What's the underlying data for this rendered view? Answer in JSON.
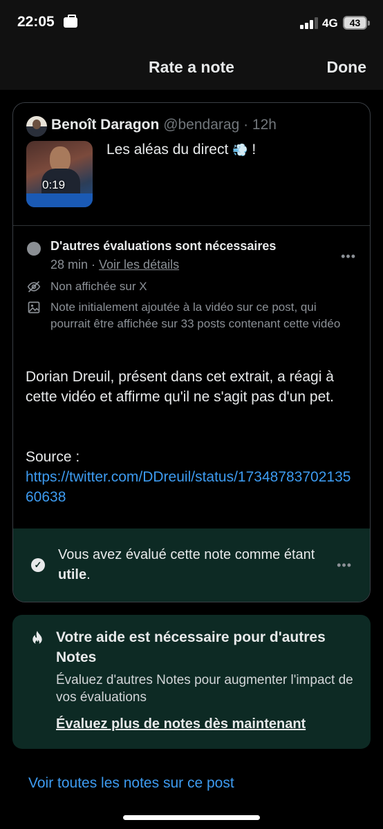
{
  "status_bar": {
    "time": "22:05",
    "network": "4G",
    "battery": "43"
  },
  "header": {
    "title": "Rate a note",
    "done_label": "Done"
  },
  "post": {
    "author_name": "Benoît Daragon",
    "author_handle": "@bendarag · 12h",
    "text": "Les aléas du direct",
    "emoji_after": "💨",
    "exclaim": " !",
    "video_duration": "0:19"
  },
  "note": {
    "status": "D'autres évaluations sont nécessaires",
    "age": "28 min",
    "separator": " · ",
    "details_link": "Voir les détails",
    "visibility": "Non affichée sur X",
    "media_info": "Note initialement ajoutée à la vidéo sur ce post, qui pourrait être affichée sur 33 posts contenant cette vidéo",
    "body": "Dorian Dreuil, présent dans cet extrait, a réagi à cette vidéo et affirme qu'il ne s'agit pas d'un pet.",
    "source_label": "Source :",
    "source_url": "https://twitter.com/DDreuil/status/1734878370213560638"
  },
  "rating": {
    "prefix": "Vous avez évalué cette note comme étant ",
    "value": "utile",
    "suffix": "."
  },
  "help": {
    "title": "Votre aide est nécessaire pour d'autres Notes",
    "description": "Évaluez d'autres Notes pour augmenter l'impact de vos évaluations",
    "cta": "Évaluez plus de notes dès maintenant"
  },
  "footer": {
    "all_notes_link": "Voir toutes les notes sur ce post"
  },
  "colors": {
    "accent": "#3d9bf0",
    "note_green": "#0d2a24",
    "muted": "#8b9096"
  },
  "icons": [
    "briefcase-icon",
    "signal-icon",
    "battery-icon",
    "video-thumbnail",
    "status-dot-icon",
    "more-icon",
    "eye-off-icon",
    "image-icon",
    "check-circle-icon",
    "flame-icon"
  ]
}
